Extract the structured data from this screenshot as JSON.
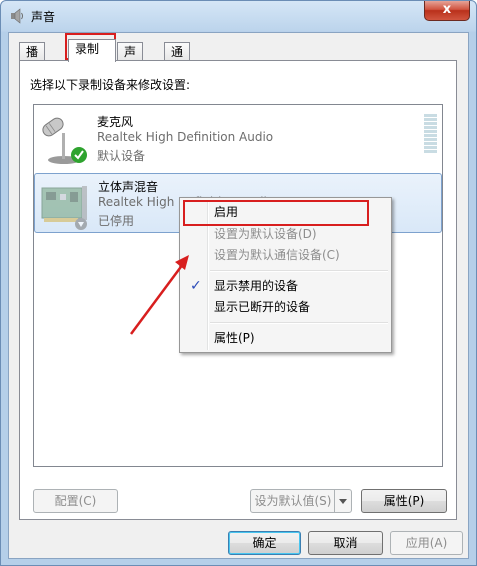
{
  "window": {
    "title": "声音",
    "close_label": "x"
  },
  "tabs": [
    {
      "label": "播放",
      "active": false
    },
    {
      "label": "录制",
      "active": true
    },
    {
      "label": "声音",
      "active": false
    },
    {
      "label": "通信",
      "active": false
    }
  ],
  "panel": {
    "instructions": "选择以下录制设备来修改设置:"
  },
  "devices": [
    {
      "name": "麦克风",
      "description": "Realtek High Definition Audio",
      "status": "默认设备",
      "icon": "microphone-icon",
      "badge": "check-badge-icon"
    },
    {
      "name": "立体声混音",
      "description": "Realtek High Definition Audio",
      "status": "已停用",
      "icon": "sound-card-icon",
      "badge": "disabled-arrow-icon"
    }
  ],
  "context_menu": {
    "items": [
      {
        "label": "启用",
        "disabled": false,
        "checked": false
      },
      {
        "label": "设置为默认设备(D)",
        "disabled": true,
        "checked": false
      },
      {
        "label": "设置为默认通信设备(C)",
        "disabled": true,
        "checked": false
      },
      {
        "label": "显示禁用的设备",
        "disabled": false,
        "checked": true
      },
      {
        "label": "显示已断开的设备",
        "disabled": false,
        "checked": false
      },
      {
        "label": "属性(P)",
        "disabled": false,
        "checked": false
      }
    ]
  },
  "buttons": {
    "configure": "配置(C)",
    "set_default": "设为默认值(S)",
    "properties": "属性(P)",
    "ok": "确定",
    "cancel": "取消",
    "apply": "应用(A)"
  },
  "colors": {
    "annotation_red": "#d81e1e",
    "selection_border": "#7da2ce",
    "check_green": "#2fa32f"
  }
}
